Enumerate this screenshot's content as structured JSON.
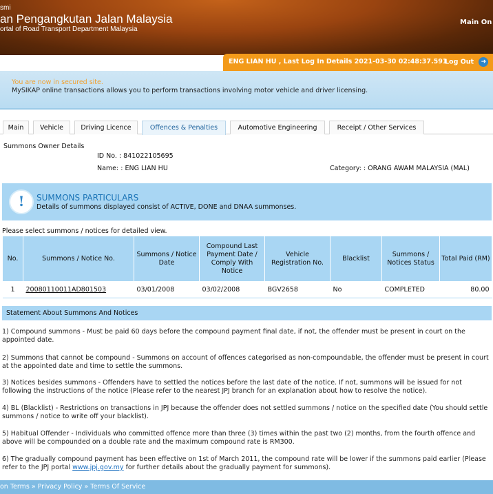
{
  "header": {
    "small_text": "smi",
    "title": "an Pengangkutan Jalan Malaysia",
    "subtitle": "ortal of Road Transport Department Malaysia",
    "nav_text": "Main On"
  },
  "userbar": {
    "user_info": "ENG LIAN HU , Last Log In Details 2021-03-30 02:48:37.591",
    "logout_label": "Log Out",
    "logout_icon": "arrow-right-icon"
  },
  "secure": {
    "line1": "You are now in secured site.",
    "line2": "MySIKAP online transactions allows you to perform transactions involving motor vehicle and driver licensing."
  },
  "tabs": [
    {
      "label": "Main"
    },
    {
      "label": "Vehicle"
    },
    {
      "label": "Driving Licence"
    },
    {
      "label": "Offences & Penalties"
    },
    {
      "label": "Automotive Engineering"
    },
    {
      "label": "Receipt / Other Services"
    }
  ],
  "owner": {
    "label": "Summons Owner Details",
    "id_text": "ID No. : 841022105695",
    "name_text": "Name: : ENG LIAN HU",
    "category_text": "Category: : ORANG AWAM MALAYSIA (MAL)"
  },
  "particulars": {
    "icon": "exclamation-icon",
    "title": "SUMMONS PARTICULARS",
    "description": "Details of summons displayed consist of ACTIVE, DONE and DNAA summonses."
  },
  "select_note": "Please select summons / notices for detailed view.",
  "table": {
    "headers": [
      "No.",
      "Summons / Notice No.",
      "Summons / Notice Date",
      "Compound Last Payment Date / Comply With Notice",
      "Vehicle Registration No.",
      "Blacklist",
      "Summons / Notices Status",
      "Total Paid (RM)"
    ],
    "rows": [
      [
        "1",
        "20080110011AD801503",
        "03/01/2008",
        "03/02/2008",
        "BGV2658",
        "No",
        "COMPLETED",
        "80.00"
      ]
    ]
  },
  "statement": {
    "title": "Statement About Summons And Notices",
    "items": [
      "1) Compound summons - Must be paid 60 days before the compound payment final date, if not, the offender must be present in court on the appointed date.",
      "2) Summons that cannot be compound - Summons on account of offences categorised as non-compoundable, the offender must be present in court at the appointed date and time to settle the summons.",
      "3) Notices besides summons - Offenders have to settled the notices before the last date of the notice. If not, summons will be issued for not following the instructions of the notice (Please refer to the nearest JPJ branch for an explanation about how to resolve the notice).",
      "4) BL (Blacklist) - Restrictions on transactions in JPJ because the offender does not settled summons / notice on the specified date (You should settle summons / notice to write off your blacklist).",
      "5) Habitual Offender - Individuals who committed offence more than three (3) times within the past two (2) months, from the fourth offence and above will be compounded on a double rate and the maximum compound rate is RM300."
    ],
    "item6_before": "6) The gradually compound payment has been effective on 1st of March 2011, the compound rate will be lower if the summons paid earlier (Please refer to the JPJ portal ",
    "item6_link": "www.jpj.gov.my",
    "item6_after": " for further details about the gradually payment for summons)."
  },
  "footer": {
    "links_text": "on Terms » Privacy Policy » Terms Of Service"
  }
}
